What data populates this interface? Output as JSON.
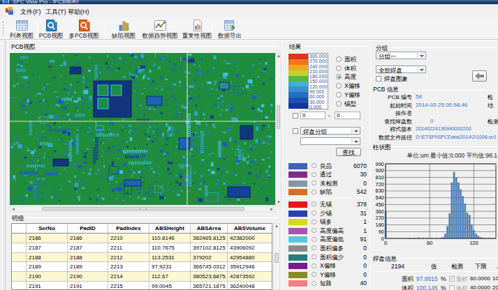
{
  "window": {
    "title": "SPC View Pro - [PCB视图]"
  },
  "menu": {
    "items": [
      {
        "label": "文件(F)"
      },
      {
        "label": "工具(T)"
      },
      {
        "label": "帮助(H)"
      }
    ]
  },
  "toolbar": {
    "buttons": [
      {
        "label": "列表视图",
        "icon": "list-view-icon"
      },
      {
        "label": "PCB视图",
        "icon": "pcb-view-icon"
      },
      {
        "label": "多PCB视图",
        "icon": "multi-pcb-view-icon"
      },
      {
        "label": "缺陷视图",
        "icon": "defect-view-icon"
      },
      {
        "label": "数据趋势视图",
        "icon": "data-trend-view-icon"
      },
      {
        "label": "重复性视图",
        "icon": "repeatability-view-icon"
      },
      {
        "label": "数据导出",
        "icon": "data-export-icon"
      }
    ]
  },
  "pcb_panel": {
    "title": "PCB视图"
  },
  "results_panel": {
    "title": "结果",
    "scale_labels": [
      "300.000",
      "270.000",
      "240.000",
      "210.000",
      "180.000",
      "150.000",
      "120.000",
      "90.000",
      "60.000",
      "30.000",
      "0.000"
    ],
    "scale_colors": [
      "#e23318",
      "#f0771c",
      "#f3a81c",
      "#c0d331",
      "#55b845",
      "#3fb0d8",
      "#3a8fd2",
      "#2a6cc2",
      "#1d4fb2",
      "#12359f"
    ],
    "radios": [
      {
        "label": "面积",
        "selected": false
      },
      {
        "label": "体积",
        "selected": false
      },
      {
        "label": "高度",
        "selected": true
      },
      {
        "label": "X偏移",
        "selected": false
      },
      {
        "label": "Y偏移",
        "selected": false
      },
      {
        "label": "锡型",
        "selected": false
      }
    ],
    "range_from": "0",
    "range_to": "0",
    "range_dash": "-",
    "group_dropdown": "焊盘分组",
    "empty_dropdown": "",
    "search_button": "查找",
    "legend": [
      {
        "label": "良品",
        "count": "6070",
        "color": "#3e62b8"
      },
      {
        "label": "通过",
        "count": "30",
        "color": "#7b2e8e"
      },
      {
        "label": "未检测",
        "count": "0",
        "color": "#8296a8"
      },
      {
        "label": "缺陷",
        "count": "542",
        "color": "#d2711e"
      },
      {
        "label": "无锡",
        "count": "378",
        "color": "#ee1518"
      },
      {
        "label": "少锡",
        "count": "31",
        "color": "#2a3fb0"
      },
      {
        "label": "锡多",
        "count": "1",
        "color": "#d8d81c"
      },
      {
        "label": "高度偏高",
        "count": "1",
        "color": "#a855a8"
      },
      {
        "label": "高度偏低",
        "count": "91",
        "color": "#55c8dc"
      },
      {
        "label": "面积偏多",
        "count": "0",
        "color": "#8a8a8a"
      },
      {
        "label": "面积偏少",
        "count": "0",
        "color": "#1f8080"
      },
      {
        "label": "X偏移",
        "count": "0",
        "color": "#7a1a8e"
      },
      {
        "label": "Y偏移",
        "count": "0",
        "color": "#8a8a24"
      },
      {
        "label": "短路",
        "count": "40",
        "color": "#f08080"
      }
    ]
  },
  "group_panel": {
    "title": "分组",
    "dropdown1": "分组一",
    "dropdown2": "全部焊盘",
    "checkbox_label": "焊盘图象",
    "back_button_icon": "left-arrow-icon"
  },
  "pcb_info": {
    "title": "PCB 信息",
    "rows": [
      {
        "label": "PCB 编号",
        "value": "58",
        "partial_right": "检"
      },
      {
        "label": "起始时间",
        "value": "2014-02-25 00:58:46",
        "partial_right": "结"
      },
      {
        "label": "操作者",
        "value": "",
        "partial_right": ""
      },
      {
        "label": "查找焊盘数",
        "value": "0",
        "partial_right": "检测"
      },
      {
        "label": "程式版本",
        "value": "20140224130940000200",
        "partial_right": ""
      },
      {
        "label": "数据文件路径",
        "value": "D:\\ETSPI\\SPCData\\2014\\2\\1006.sv1",
        "partial_right": ""
      }
    ]
  },
  "histogram_panel": {
    "title": "柱状图",
    "note": "单位:um 最小值:0.000 平均值:98.1"
  },
  "chart_data": {
    "type": "bar",
    "title": "柱状图",
    "xlabel": "um",
    "ylabel": "",
    "xlim": [
      0,
      150
    ],
    "ylim": [
      0,
      990
    ],
    "x_ticks": [
      0,
      60,
      120
    ],
    "y_ticks": [
      0,
      90,
      180,
      270,
      360,
      450,
      540,
      630,
      720,
      810,
      900,
      990
    ],
    "grid": true,
    "bar_color": "#4f81bd",
    "unit": "um",
    "min_value": 0.0,
    "mean_value": 98.1,
    "x": [
      0,
      33,
      39,
      45,
      51,
      57,
      63,
      69,
      75,
      78,
      81,
      84,
      87,
      90,
      93,
      96,
      99,
      102,
      105,
      108,
      111,
      114,
      117,
      120,
      123,
      126,
      129,
      132,
      135,
      141,
      147
    ],
    "values": [
      355,
      6,
      8,
      10,
      8,
      5,
      5,
      6,
      8,
      15,
      60,
      160,
      330,
      740,
      880,
      810,
      740,
      650,
      560,
      460,
      340,
      310,
      180,
      110,
      60,
      30,
      15,
      8,
      5,
      4,
      3
    ]
  },
  "pad_info": {
    "title": "焊盘信息",
    "pad_id": "2194",
    "col_value": "值",
    "col_detect": "检测",
    "col_lower": "下限",
    "col_upper_partial": ".",
    "rows": [
      {
        "name": "面积",
        "value": "97.8815",
        "unit": "%",
        "check_label": "面积",
        "checked": true,
        "lower": "60.0000",
        "upper_partial": "100."
      },
      {
        "name": "体积",
        "value": "100.145",
        "unit": "%",
        "check_label": "体积",
        "checked": false,
        "lower": "40.0000",
        "upper_partial": "200."
      }
    ]
  },
  "detail_panel": {
    "title": "明细",
    "columns": [
      "SerNo",
      "PadID",
      "PadIndex",
      "ABSHeight",
      "ABSArea",
      "ABSVolume"
    ],
    "rows": [
      [
        "2186",
        "2186",
        "2210",
        "110.8146",
        "382465.8125",
        "42382000"
      ],
      [
        "2187",
        "2187",
        "2211",
        "110.7675",
        "397102.8125",
        "43906092"
      ],
      [
        "2188",
        "2188",
        "2212",
        "113.2531",
        "379202",
        "42954880"
      ],
      [
        "2189",
        "2189",
        "2213",
        "97.9231",
        "366745.0312",
        "35912946"
      ],
      [
        "2190",
        "2190",
        "2214",
        "112.67",
        "380523.6875",
        "42873592"
      ],
      [
        "2191",
        "2191",
        "2215",
        "99.0045",
        "365721.1875",
        "36240048"
      ]
    ]
  },
  "colors": {
    "pcb_green": "#1f8c3e",
    "row_alt": "#fbf8d2",
    "value_blue": "#3377cc"
  }
}
